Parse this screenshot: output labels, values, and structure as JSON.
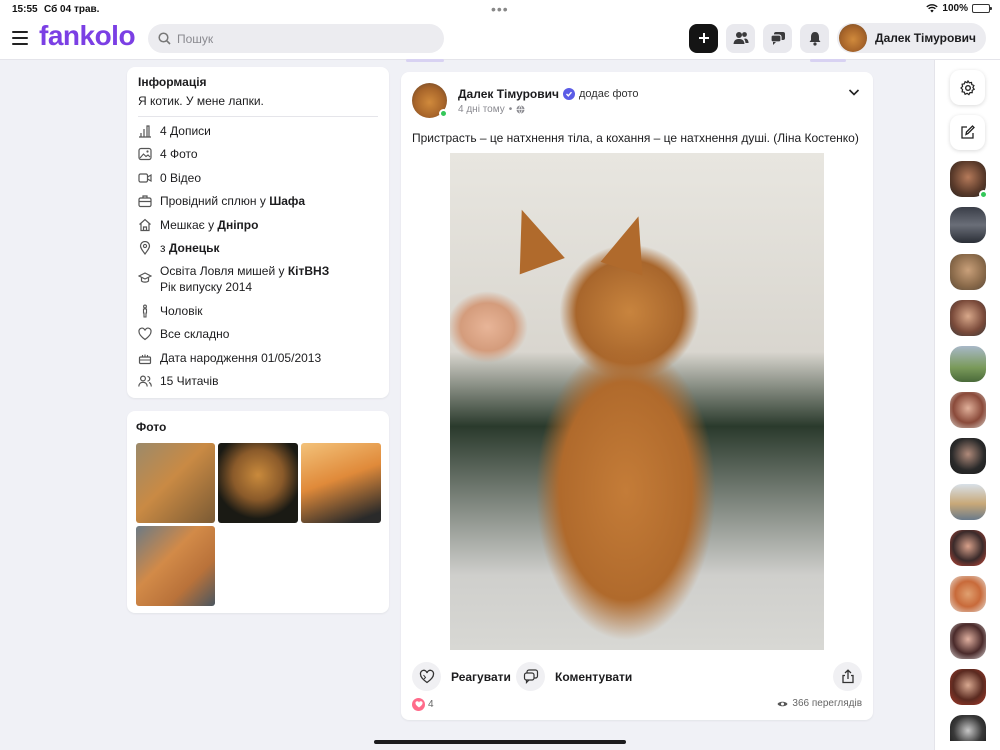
{
  "status_bar": {
    "time": "15:55",
    "date": "Сб 04 трав.",
    "battery": "100%"
  },
  "header": {
    "logo": "fankolo",
    "search_placeholder": "Пошук",
    "profile_name": "Далек Тімурович",
    "icons": [
      "menu-icon",
      "search-icon",
      "plus-icon",
      "friends-icon",
      "messages-icon",
      "bell-icon"
    ]
  },
  "info": {
    "title": "Інформація",
    "bio": "Я котик. У мене лапки.",
    "items": [
      {
        "icon": "posts-icon",
        "text": "4 Дописи"
      },
      {
        "icon": "photo-icon",
        "text": "4 Фото"
      },
      {
        "icon": "video-icon",
        "text": "0 Відео"
      },
      {
        "icon": "briefcase-icon",
        "prefix": "Провідний сплюн у ",
        "bold": "Шафа"
      },
      {
        "icon": "home-icon",
        "prefix": "Мешкає у ",
        "bold": "Дніпро"
      },
      {
        "icon": "location-icon",
        "prefix": "з ",
        "bold": "Донецьк"
      },
      {
        "icon": "education-icon",
        "prefix": "Освіта Ловля мишей у ",
        "bold": "КітВНЗ",
        "line2": "Рік випуску 2014"
      },
      {
        "icon": "gender-icon",
        "text": "Чоловік"
      },
      {
        "icon": "heart-icon",
        "text": "Все складно"
      },
      {
        "icon": "birthday-icon",
        "text": "Дата народження 01/05/2013"
      },
      {
        "icon": "followers-icon",
        "text": "15 Читачів"
      }
    ]
  },
  "photos": {
    "title": "Фото"
  },
  "post": {
    "author": "Далек Тімурович",
    "action": "додає фото",
    "time": "4 дні тому",
    "separator": "•",
    "text": "Пристрасть – це натхнення тіла, а кохання – це натхнення душі. (Ліна Костенко)",
    "react_label": "Реагувати",
    "comment_label": "Коментувати",
    "likes_count": "4",
    "views": "366 переглядів"
  },
  "colors": {
    "brand": "#7b3fe4",
    "online": "#34c759",
    "verified": "#5b5ce6",
    "like": "#ff6b8a"
  }
}
